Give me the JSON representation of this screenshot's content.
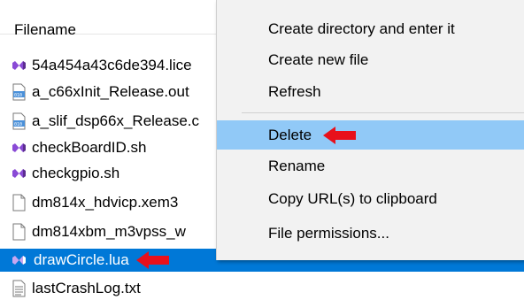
{
  "file_list": {
    "header": "Filename",
    "files": [
      {
        "name": "54a454a43c6de394.lice",
        "icon": "visual-studio-icon"
      },
      {
        "name": "a_c66xInit_Release.out",
        "icon": "binary-file-icon"
      },
      {
        "name": "a_slif_dsp66x_Release.c",
        "icon": "binary-file-icon"
      },
      {
        "name": "checkBoardID.sh",
        "icon": "visual-studio-icon"
      },
      {
        "name": "checkgpio.sh",
        "icon": "visual-studio-icon"
      },
      {
        "name": "dm814x_hdvicp.xem3",
        "icon": "blank-file-icon"
      },
      {
        "name": "dm814xbm_m3vpss_w",
        "icon": "blank-file-icon"
      },
      {
        "name": "drawCircle.lua",
        "icon": "visual-studio-icon",
        "selected": true
      },
      {
        "name": "lastCrashLog.txt",
        "icon": "text-file-icon"
      }
    ]
  },
  "context_menu": {
    "items": [
      {
        "label": "Create directory and enter it"
      },
      {
        "label": "Create new file"
      },
      {
        "label": "Refresh"
      },
      {
        "label": "Delete",
        "highlighted": true
      },
      {
        "label": "Rename"
      },
      {
        "label": "Copy URL(s) to clipboard"
      },
      {
        "label": "File permissions..."
      }
    ]
  },
  "colors": {
    "selection": "#0078d7",
    "menu_hover": "#91c9f7",
    "annotation_arrow": "#e8101b",
    "vs_icon": "#8a4bd6"
  },
  "annotations": [
    "red-arrow-pointing-to-delete",
    "red-arrow-pointing-to-drawCircle"
  ]
}
